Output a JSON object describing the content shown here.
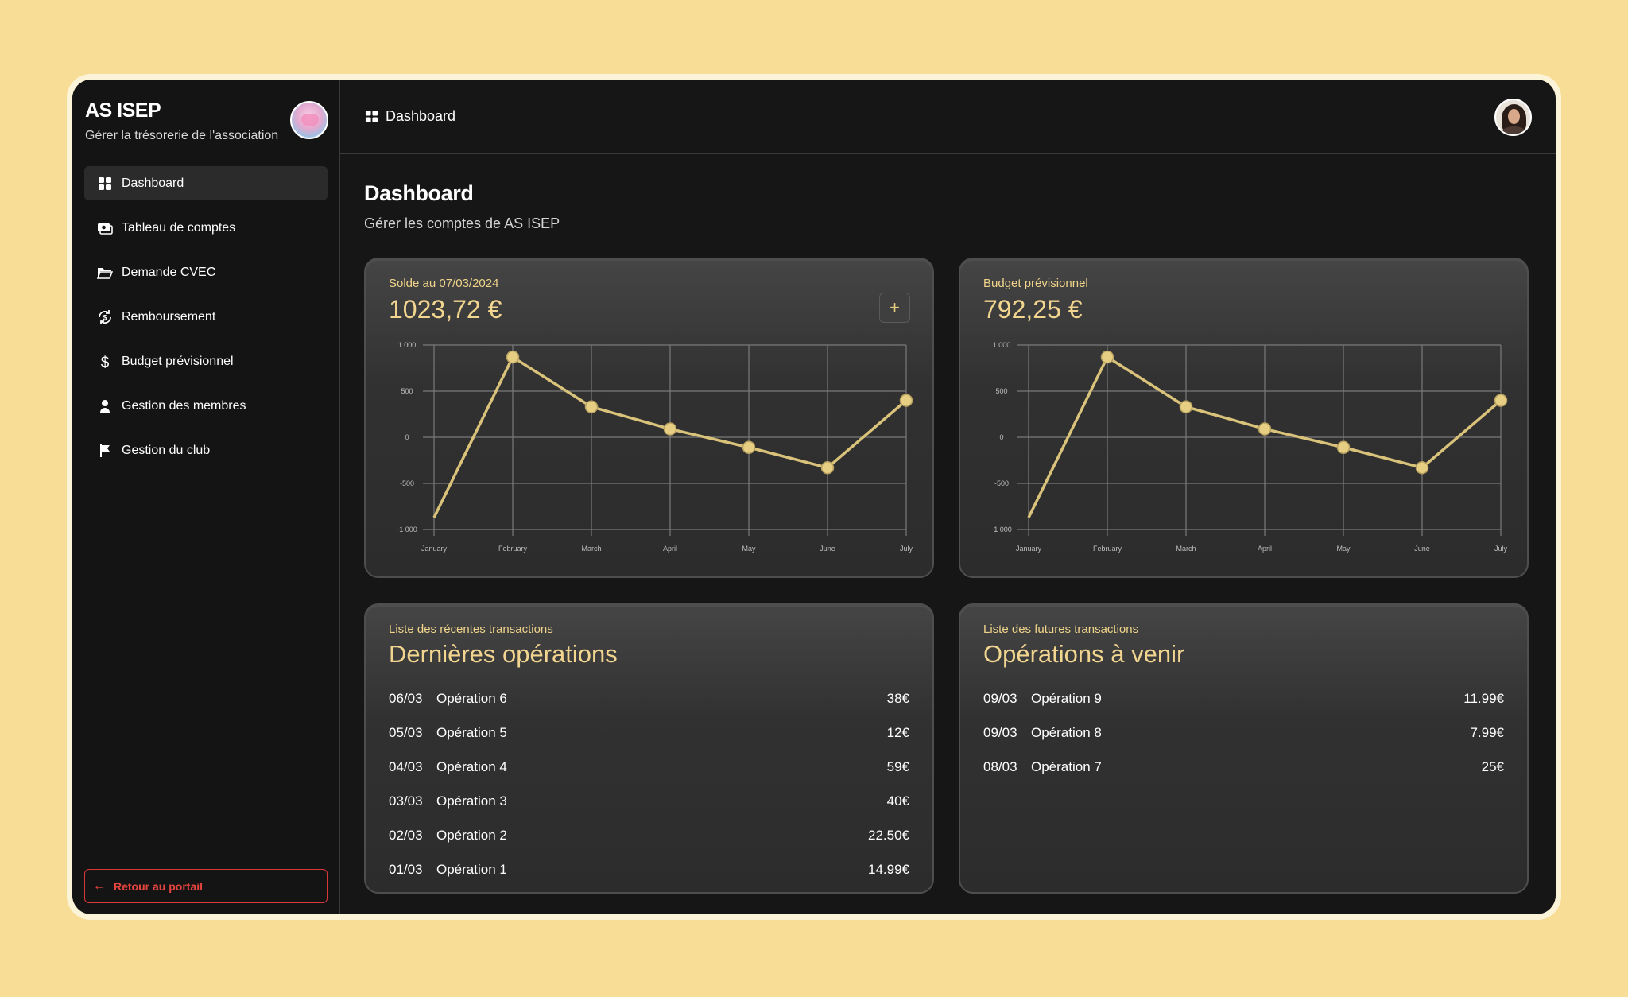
{
  "sidebar": {
    "brand_title": "AS ISEP",
    "brand_subtitle": "Gérer la trésorerie de l'association",
    "items": [
      {
        "label": "Dashboard",
        "icon": "grid-icon",
        "active": true
      },
      {
        "label": "Tableau de comptes",
        "icon": "money-icon",
        "active": false
      },
      {
        "label": "Demande CVEC",
        "icon": "folder-icon",
        "active": false
      },
      {
        "label": "Remboursement",
        "icon": "refund-icon",
        "active": false
      },
      {
        "label": "Budget prévisionnel",
        "icon": "dollar-icon",
        "active": false
      },
      {
        "label": "Gestion des membres",
        "icon": "user-icon",
        "active": false
      },
      {
        "label": "Gestion du club",
        "icon": "flag-icon",
        "active": false
      }
    ],
    "back_label": "Retour au portail"
  },
  "topbar": {
    "breadcrumb": "Dashboard"
  },
  "page": {
    "title": "Dashboard",
    "subtitle": "Gérer les comptes de AS ISEP"
  },
  "balance_card": {
    "label": "Solde au 07/03/2024",
    "value": "1023,72 €",
    "add_label": "+"
  },
  "budget_card": {
    "label": "Budget prévisionnel",
    "value": "792,25 €"
  },
  "recent_card": {
    "label": "Liste des récentes transactions",
    "heading": "Dernières opérations",
    "rows": [
      {
        "date": "06/03",
        "name": "Opération 6",
        "amount": "38€"
      },
      {
        "date": "05/03",
        "name": "Opération 5",
        "amount": "12€"
      },
      {
        "date": "04/03",
        "name": "Opération 4",
        "amount": "59€"
      },
      {
        "date": "03/03",
        "name": "Opération 3",
        "amount": "40€"
      },
      {
        "date": "02/03",
        "name": "Opération 2",
        "amount": "22.50€"
      },
      {
        "date": "01/03",
        "name": "Opération 1",
        "amount": "14.99€"
      }
    ]
  },
  "upcoming_card": {
    "label": "Liste des futures transactions",
    "heading": "Opérations à venir",
    "rows": [
      {
        "date": "09/03",
        "name": "Opération 9",
        "amount": "11.99€"
      },
      {
        "date": "09/03",
        "name": "Opération 8",
        "amount": "7.99€"
      },
      {
        "date": "08/03",
        "name": "Opération 7",
        "amount": "25€"
      }
    ]
  },
  "colors": {
    "accent": "#d9c27a",
    "danger": "#e8453f",
    "background": "#161616"
  },
  "chart_data": [
    {
      "type": "line",
      "x": [
        "January",
        "February",
        "March",
        "April",
        "May",
        "June",
        "July"
      ],
      "values": [
        -870,
        870,
        330,
        90,
        -110,
        -330,
        400
      ],
      "yticks": [
        "1 000",
        "500",
        "0",
        "-500",
        "-1 000"
      ],
      "ylim": [
        -1000,
        1000
      ],
      "grid": true
    },
    {
      "type": "line",
      "x": [
        "January",
        "February",
        "March",
        "April",
        "May",
        "June",
        "July"
      ],
      "values": [
        -870,
        870,
        330,
        90,
        -110,
        -330,
        400
      ],
      "yticks": [
        "1 000",
        "500",
        "0",
        "-500",
        "-1 000"
      ],
      "ylim": [
        -1000,
        1000
      ],
      "grid": true
    }
  ]
}
